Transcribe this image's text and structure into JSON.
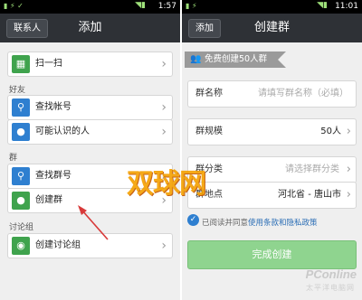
{
  "left": {
    "status_time": "1:57",
    "back_label": "联系人",
    "title": "添加",
    "scan_label": "扫一扫",
    "section_friends": "好友",
    "find_account_label": "查找帐号",
    "may_know_label": "可能认识的人",
    "section_group": "群",
    "find_group_label": "查找群号",
    "create_group_label": "创建群",
    "section_discussion": "讨论组",
    "create_discussion_label": "创建讨论组"
  },
  "right": {
    "status_time": "11:01",
    "back_label": "添加",
    "title": "创建群",
    "banner_text": "免费创建50人群",
    "name_label": "群名称",
    "name_placeholder": "请填写群名称（必填）",
    "size_label": "群规模",
    "size_value": "50人",
    "category_label": "群分类",
    "category_placeholder": "请选择群分类",
    "location_label": "群地点",
    "location_value": "河北省 - 唐山市",
    "agree_prefix": "已阅读并同意",
    "agree_link": "使用条款和隐私政策",
    "submit_label": "完成创建"
  },
  "watermark": {
    "cn": "双球网",
    "brand": "PConline",
    "brand_sub": "太平洋电脑网"
  },
  "icons": [
    "scan-icon",
    "search-icon",
    "person-icon",
    "group-search-icon",
    "add-group-icon",
    "chat-bubble-icon",
    "chevron-right-icon",
    "group-banner-icon",
    "check-icon"
  ],
  "colors": {
    "titlebar": "#2e3136",
    "accent_green": "#8fd48f",
    "link": "#2a6db5"
  }
}
